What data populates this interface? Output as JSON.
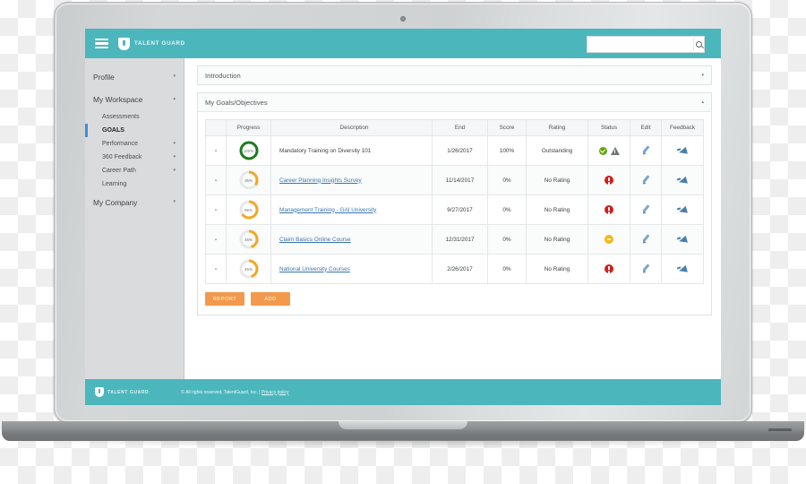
{
  "header": {
    "brand": "TALENT GUARD",
    "menu_icon": "hamburger-icon",
    "logo_icon": "shield-logo-icon",
    "search": {
      "value": "",
      "placeholder": "",
      "icon": "search-icon"
    }
  },
  "sidebar": {
    "items": [
      {
        "label": "Profile",
        "type": "top",
        "caret": "▾"
      },
      {
        "label": "My Workspace",
        "type": "top",
        "caret": "▴"
      },
      {
        "label": "Assessments",
        "type": "sub",
        "caret": ""
      },
      {
        "label": "GOALS",
        "type": "sub",
        "caret": "",
        "active": true
      },
      {
        "label": "Performance",
        "type": "sub",
        "caret": "▾"
      },
      {
        "label": "360 Feedback",
        "type": "sub",
        "caret": "▾"
      },
      {
        "label": "Career Path",
        "type": "sub",
        "caret": "▾"
      },
      {
        "label": "Learning",
        "type": "sub",
        "caret": ""
      },
      {
        "label": "My Company",
        "type": "top",
        "caret": "▾"
      }
    ]
  },
  "panels": {
    "introduction": {
      "title": "Introduction",
      "caret": "▾"
    },
    "goals": {
      "title": "My Goals/Objectives",
      "caret": "▴"
    }
  },
  "table": {
    "columns": [
      "",
      "Progress",
      "Description",
      "End",
      "Score",
      "Rating",
      "Status",
      "Edit",
      "Feedback"
    ],
    "rows": [
      {
        "expander": "▪",
        "progress": 100,
        "progress_label": "100%",
        "progress_color": "#1f7a1f",
        "description": "Mandatory Training on Diversity 101",
        "is_link": false,
        "end": "1/26/2017",
        "score": "100%",
        "rating": "Outstanding",
        "status": [
          "check-icon",
          "warning-icon"
        ],
        "edit": "edit-pencil-icon",
        "feedback": "megaphone-icon"
      },
      {
        "expander": "▪",
        "progress": 35,
        "progress_label": "35%",
        "progress_color": "#f5a623",
        "description": "Career Planning Insights Survey",
        "is_link": true,
        "end": "11/14/2017",
        "score": "0%",
        "rating": "No Rating",
        "status": [
          "alert-icon"
        ],
        "edit": "edit-pencil-icon",
        "feedback": "megaphone-icon"
      },
      {
        "expander": "▪",
        "progress": 65,
        "progress_label": "65%",
        "progress_color": "#f5a623",
        "description": "Management Training - GAI University",
        "is_link": true,
        "end": "9/27/2017",
        "score": "0%",
        "rating": "No Rating",
        "status": [
          "alert-icon"
        ],
        "edit": "edit-pencil-icon",
        "feedback": "megaphone-icon"
      },
      {
        "expander": "▪",
        "progress": 45,
        "progress_label": "45%",
        "progress_color": "#f5a623",
        "description": "Claim Basics Online Course",
        "is_link": true,
        "end": "12/31/2017",
        "score": "0%",
        "rating": "No Rating",
        "status": [
          "pause-icon"
        ],
        "edit": "edit-pencil-icon",
        "feedback": "megaphone-icon"
      },
      {
        "expander": "▪",
        "progress": 45,
        "progress_label": "45%",
        "progress_color": "#f5a623",
        "description": "National University Courses",
        "is_link": true,
        "end": "2/26/2017",
        "score": "0%",
        "rating": "No Rating",
        "status": [
          "alert-icon"
        ],
        "edit": "edit-pencil-icon",
        "feedback": "megaphone-icon"
      }
    ]
  },
  "actions": {
    "report_label": "REPORT",
    "add_label": "ADD"
  },
  "footer": {
    "brand": "TALENT GUARD",
    "copyright": "© All rights reserved. TalentGuard, Inc. | ",
    "privacy_label": "Privacy policy"
  },
  "colors": {
    "teal": "#4cb6bd",
    "orange": "#f2994b",
    "progress_orange": "#f5a623",
    "progress_green": "#1f7a1f",
    "link_blue": "#3a74ad",
    "alert_red": "#d0201c",
    "pause_yellow": "#f1b91b",
    "check_green": "#63a70a"
  }
}
